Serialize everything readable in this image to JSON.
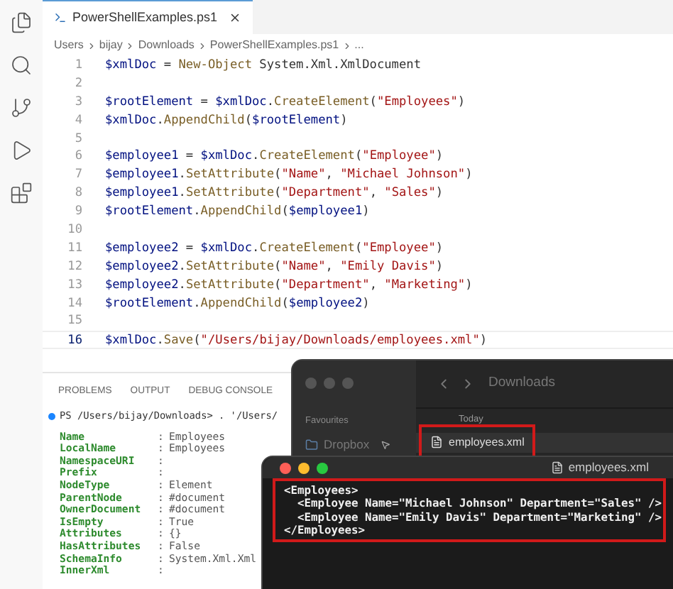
{
  "editor_tab": {
    "label": "PowerShellExamples.ps1",
    "selected": true
  },
  "breadcrumb": [
    "Users",
    "bijay",
    "Downloads",
    "PowerShellExamples.ps1",
    "..."
  ],
  "code": [
    {
      "number": "1",
      "current": false,
      "tokens": [
        {
          "text": "$xmlDoc",
          "kind": "var"
        },
        {
          "text": " = ",
          "kind": "plain"
        },
        {
          "text": "New-Object",
          "kind": "func"
        },
        {
          "text": " System.Xml.XmlDocument",
          "kind": "plain"
        }
      ]
    },
    {
      "number": "2",
      "current": false
    },
    {
      "number": "3",
      "current": false,
      "tokens": [
        {
          "text": "$rootElement",
          "kind": "var"
        },
        {
          "text": " = ",
          "kind": "plain"
        },
        {
          "text": "$xmlDoc",
          "kind": "var"
        },
        {
          "text": ".",
          "kind": "plain"
        },
        {
          "text": "CreateElement",
          "kind": "func"
        },
        {
          "text": "(",
          "kind": "plain"
        },
        {
          "text": "\"Employees\"",
          "kind": "string"
        },
        {
          "text": ")",
          "kind": "plain"
        }
      ]
    },
    {
      "number": "4",
      "current": false,
      "tokens": [
        {
          "text": "$xmlDoc",
          "kind": "var"
        },
        {
          "text": ".",
          "kind": "plain"
        },
        {
          "text": "AppendChild",
          "kind": "func"
        },
        {
          "text": "(",
          "kind": "plain"
        },
        {
          "text": "$rootElement",
          "kind": "var"
        },
        {
          "text": ")",
          "kind": "plain"
        }
      ]
    },
    {
      "number": "5",
      "current": false
    },
    {
      "number": "6",
      "current": false,
      "tokens": [
        {
          "text": "$employee1",
          "kind": "var"
        },
        {
          "text": " = ",
          "kind": "plain"
        },
        {
          "text": "$xmlDoc",
          "kind": "var"
        },
        {
          "text": ".",
          "kind": "plain"
        },
        {
          "text": "CreateElement",
          "kind": "func"
        },
        {
          "text": "(",
          "kind": "plain"
        },
        {
          "text": "\"Employee\"",
          "kind": "string"
        },
        {
          "text": ")",
          "kind": "plain"
        }
      ]
    },
    {
      "number": "7",
      "current": false,
      "tokens": [
        {
          "text": "$employee1",
          "kind": "var"
        },
        {
          "text": ".",
          "kind": "plain"
        },
        {
          "text": "SetAttribute",
          "kind": "func"
        },
        {
          "text": "(",
          "kind": "plain"
        },
        {
          "text": "\"Name\"",
          "kind": "string"
        },
        {
          "text": ", ",
          "kind": "plain"
        },
        {
          "text": "\"Michael Johnson\"",
          "kind": "string"
        },
        {
          "text": ")",
          "kind": "plain"
        }
      ]
    },
    {
      "number": "8",
      "current": false,
      "tokens": [
        {
          "text": "$employee1",
          "kind": "var"
        },
        {
          "text": ".",
          "kind": "plain"
        },
        {
          "text": "SetAttribute",
          "kind": "func"
        },
        {
          "text": "(",
          "kind": "plain"
        },
        {
          "text": "\"Department\"",
          "kind": "string"
        },
        {
          "text": ", ",
          "kind": "plain"
        },
        {
          "text": "\"Sales\"",
          "kind": "string"
        },
        {
          "text": ")",
          "kind": "plain"
        }
      ]
    },
    {
      "number": "9",
      "current": false,
      "tokens": [
        {
          "text": "$rootElement",
          "kind": "var"
        },
        {
          "text": ".",
          "kind": "plain"
        },
        {
          "text": "AppendChild",
          "kind": "func"
        },
        {
          "text": "(",
          "kind": "plain"
        },
        {
          "text": "$employee1",
          "kind": "var"
        },
        {
          "text": ")",
          "kind": "plain"
        }
      ]
    },
    {
      "number": "10",
      "current": false
    },
    {
      "number": "11",
      "current": false,
      "tokens": [
        {
          "text": "$employee2",
          "kind": "var"
        },
        {
          "text": " = ",
          "kind": "plain"
        },
        {
          "text": "$xmlDoc",
          "kind": "var"
        },
        {
          "text": ".",
          "kind": "plain"
        },
        {
          "text": "CreateElement",
          "kind": "func"
        },
        {
          "text": "(",
          "kind": "plain"
        },
        {
          "text": "\"Employee\"",
          "kind": "string"
        },
        {
          "text": ")",
          "kind": "plain"
        }
      ]
    },
    {
      "number": "12",
      "current": false,
      "tokens": [
        {
          "text": "$employee2",
          "kind": "var"
        },
        {
          "text": ".",
          "kind": "plain"
        },
        {
          "text": "SetAttribute",
          "kind": "func"
        },
        {
          "text": "(",
          "kind": "plain"
        },
        {
          "text": "\"Name\"",
          "kind": "string"
        },
        {
          "text": ", ",
          "kind": "plain"
        },
        {
          "text": "\"Emily Davis\"",
          "kind": "string"
        },
        {
          "text": ")",
          "kind": "plain"
        }
      ]
    },
    {
      "number": "13",
      "current": false,
      "tokens": [
        {
          "text": "$employee2",
          "kind": "var"
        },
        {
          "text": ".",
          "kind": "plain"
        },
        {
          "text": "SetAttribute",
          "kind": "func"
        },
        {
          "text": "(",
          "kind": "plain"
        },
        {
          "text": "\"Department\"",
          "kind": "string"
        },
        {
          "text": ", ",
          "kind": "plain"
        },
        {
          "text": "\"Marketing\"",
          "kind": "string"
        },
        {
          "text": ")",
          "kind": "plain"
        }
      ]
    },
    {
      "number": "14",
      "current": false,
      "tokens": [
        {
          "text": "$rootElement",
          "kind": "var"
        },
        {
          "text": ".",
          "kind": "plain"
        },
        {
          "text": "AppendChild",
          "kind": "func"
        },
        {
          "text": "(",
          "kind": "plain"
        },
        {
          "text": "$employee2",
          "kind": "var"
        },
        {
          "text": ")",
          "kind": "plain"
        }
      ]
    },
    {
      "number": "15",
      "current": false
    },
    {
      "number": "16",
      "current": true,
      "tokens": [
        {
          "text": "$xmlDoc",
          "kind": "var"
        },
        {
          "text": ".",
          "kind": "plain"
        },
        {
          "text": "Save",
          "kind": "func"
        },
        {
          "text": "(",
          "kind": "plain"
        },
        {
          "text": "\"/Users/bijay/Downloads/employees.xml\"",
          "kind": "string"
        },
        {
          "text": ")",
          "kind": "plain"
        }
      ]
    }
  ],
  "panel_tabs": [
    {
      "label": "PROBLEMS",
      "selected": false
    },
    {
      "label": "OUTPUT",
      "selected": false
    },
    {
      "label": "DEBUG CONSOLE",
      "selected": false
    }
  ],
  "terminal": {
    "prompt": "PS /Users/bijay/Downloads> . '/Users/",
    "properties": [
      {
        "name": "Name",
        "colon": ":",
        "value": "Employees"
      },
      {
        "name": "LocalName",
        "colon": ":",
        "value": "Employees"
      },
      {
        "name": "NamespaceURI",
        "colon": ":"
      },
      {
        "name": "Prefix",
        "colon": ":"
      },
      {
        "name": "NodeType",
        "colon": ":",
        "value": "Element"
      },
      {
        "name": "ParentNode",
        "colon": ":",
        "value": "#document"
      },
      {
        "name": "OwnerDocument",
        "colon": ":",
        "value": "#document"
      },
      {
        "name": "IsEmpty",
        "colon": ":",
        "value": "True"
      },
      {
        "name": "Attributes",
        "colon": ":",
        "value": "{}"
      },
      {
        "name": "HasAttributes",
        "colon": ":",
        "value": "False"
      },
      {
        "name": "SchemaInfo",
        "colon": ":",
        "value": "System.Xml.Xml"
      },
      {
        "name": "InnerXml",
        "colon": ":"
      }
    ]
  },
  "finder": {
    "title": "Downloads",
    "sidebar_heading": "Favourites",
    "sidebar_items": [
      "Dropbox"
    ],
    "group_label": "Today",
    "files": [
      {
        "name": "employees.xml",
        "highlighted": true
      }
    ]
  },
  "text_window": {
    "title": "employees.xml",
    "highlighted": true,
    "lines": [
      "<Employees>",
      "  <Employee Name=\"Michael Johnson\" Department=\"Sales\" />",
      "  <Employee Name=\"Emily Davis\" Department=\"Marketing\" />",
      "</Employees>"
    ]
  }
}
